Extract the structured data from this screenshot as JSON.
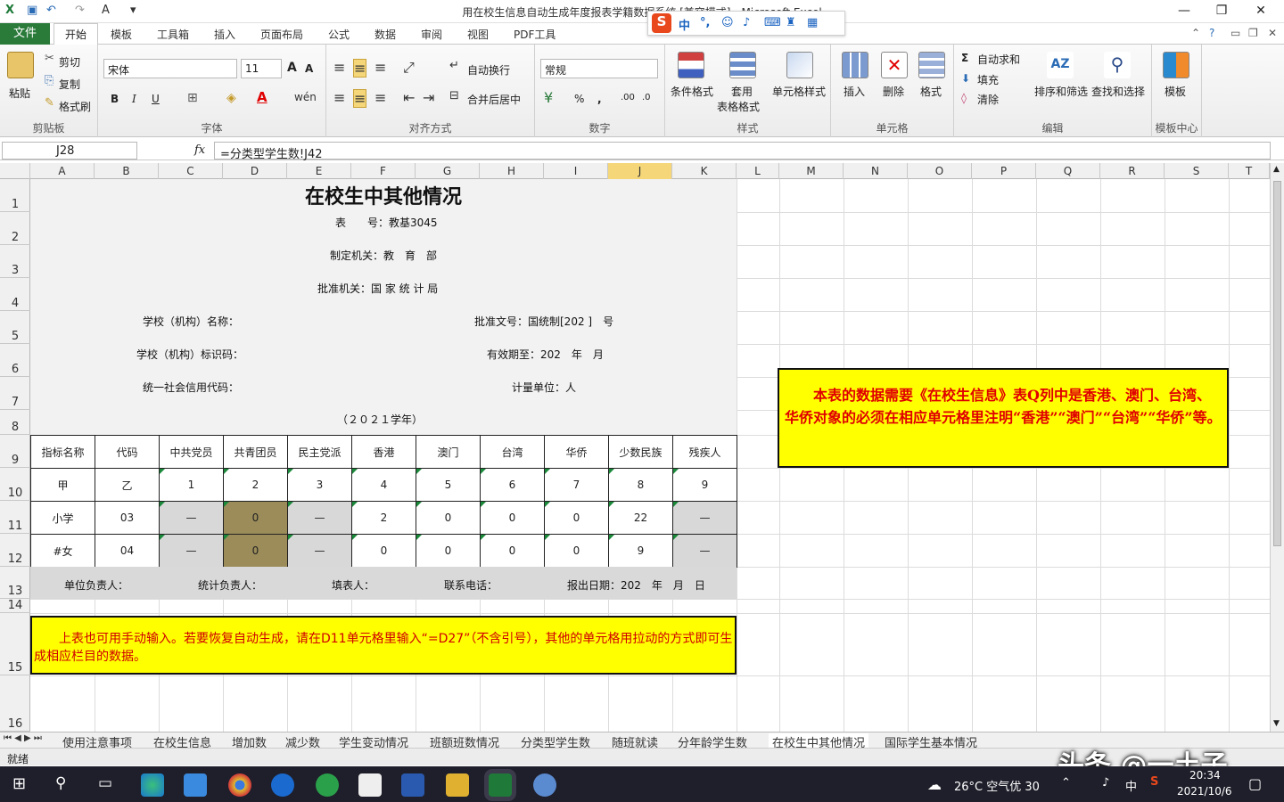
{
  "window": {
    "title": "用在校生信息自动生成年度报表学籍数据系统 [兼容模式] - Microsoft Excel"
  },
  "tabs": {
    "file": "文件",
    "items": [
      "开始",
      "模板",
      "工具箱",
      "插入",
      "页面布局",
      "公式",
      "数据",
      "审阅",
      "视图",
      "PDF工具"
    ]
  },
  "ribbon": {
    "clipboard": {
      "label": "剪贴板",
      "paste": "粘贴",
      "cut": "剪切",
      "copy": "复制",
      "format_painter": "格式刷"
    },
    "font": {
      "label": "字体",
      "name": "宋体",
      "size": "11"
    },
    "align": {
      "label": "对齐方式",
      "wrap": "自动换行",
      "merge": "合并后居中"
    },
    "number": {
      "label": "数字",
      "format": "常规"
    },
    "styles": {
      "label": "样式",
      "cond": "条件格式",
      "table": "套用",
      "table2": "表格格式",
      "cell": "单元格样式"
    },
    "cells": {
      "label": "单元格",
      "insert": "插入",
      "delete": "删除",
      "format": "格式"
    },
    "edit": {
      "label": "编辑",
      "autosum": "自动求和",
      "fill": "填充",
      "clear": "清除",
      "sort": "排序和筛选",
      "find": "查找和选择"
    },
    "template": {
      "label": "模板中心",
      "tpl": "模板"
    }
  },
  "formula_bar": {
    "cell": "J28",
    "fx": "fx",
    "formula": "=分类型学生数!J42"
  },
  "columns": [
    "A",
    "B",
    "C",
    "D",
    "E",
    "F",
    "G",
    "H",
    "I",
    "J",
    "K",
    "L",
    "M",
    "N",
    "O",
    "P",
    "Q",
    "R",
    "S",
    "T"
  ],
  "rows": [
    "1",
    "2",
    "3",
    "4",
    "5",
    "6",
    "7",
    "8",
    "9",
    "10",
    "11",
    "12",
    "13",
    "14",
    "15",
    "16"
  ],
  "form": {
    "title": "在校生中其他情况",
    "table_no": "表　　号：教基3045",
    "maker": "制定机关：教　育　部",
    "approver": "批准机关：国 家 统 计 局",
    "school_name": "学校（机构）名称：",
    "approval_no": "批准文号：国统制[202 ]　号",
    "school_id": "学校（机构）标识码：",
    "valid_until": "有效期至：202　年　月",
    "credit_code": "统一社会信用代码：",
    "unit": "计量单位：人",
    "year": "（２０２１学年）",
    "headers": [
      "指标名称",
      "代码",
      "中共党员",
      "共青团员",
      "民主党派",
      "香港",
      "澳门",
      "台湾",
      "华侨",
      "少数民族",
      "残疾人"
    ],
    "index_row": [
      "甲",
      "乙",
      "1",
      "2",
      "3",
      "4",
      "5",
      "6",
      "7",
      "8",
      "9"
    ],
    "rows": [
      [
        "小学",
        "03",
        "—",
        "0",
        "—",
        "2",
        "0",
        "0",
        "0",
        "22",
        "—"
      ],
      [
        "#女",
        "04",
        "—",
        "0",
        "—",
        "0",
        "0",
        "0",
        "0",
        "9",
        "—"
      ]
    ],
    "footer": {
      "head": "单位负责人：",
      "stat": "统计负责人：",
      "filler": "填表人：",
      "phone": "联系电话：",
      "date": "报出日期：202　年　月　日"
    }
  },
  "note_right": "本表的数据需要《在校生信息》表Q列中是香港、澳门、台湾、华侨对象的必须在相应单元格里注明“香港”“澳门”“台湾”“华侨”等。",
  "note_bottom": "上表也可用手动输入。若要恢复自动生成，请在D11单元格里输入“=D27”（不含引号），其他的单元格用拉动的方式即可生成相应栏目的数据。",
  "sheets": [
    "使用注意事项",
    "在校生信息",
    "增加数",
    "减少数",
    "学生变动情况",
    "班额班数情况",
    "分类型学生数",
    "随班就读",
    "分年龄学生数",
    "在校生中其他情况",
    "国际学生基本情况"
  ],
  "status": "就绪",
  "taskbar": {
    "weather": "26°C 空气优 30",
    "ime": "中",
    "time": "20:34",
    "date": "2021/10/6"
  },
  "watermark": "头条 @一土子"
}
